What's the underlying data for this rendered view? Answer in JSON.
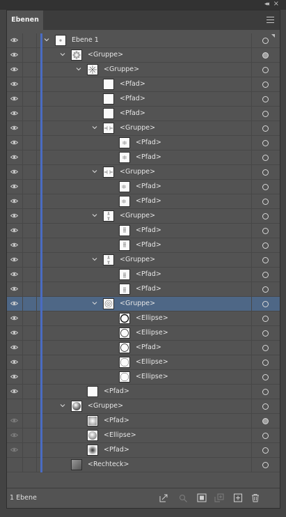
{
  "window": {
    "collapse_glyph": "◂◂",
    "close_glyph": "×"
  },
  "tab": {
    "label": "Ebenen"
  },
  "menu": {
    "icon": "panel-menu-icon"
  },
  "colors": {
    "layer_color": "#4a6cc2",
    "selection": "#4e6786",
    "panel_bg": "#535353"
  },
  "rows": [
    {
      "label": "Ebene 1",
      "indent": 0,
      "chevron": "open",
      "thumb": "layer-dot",
      "visible": true,
      "target": "empty",
      "selected": false,
      "type": "layer"
    },
    {
      "label": "<Gruppe>",
      "indent": 1,
      "chevron": "open",
      "thumb": "gear",
      "visible": true,
      "target": "filled",
      "selected": false
    },
    {
      "label": "<Gruppe>",
      "indent": 2,
      "chevron": "open",
      "thumb": "star",
      "visible": true,
      "target": "empty",
      "selected": false
    },
    {
      "label": "<Pfad>",
      "indent": 3,
      "chevron": "none",
      "thumb": "blank",
      "visible": true,
      "target": "empty",
      "selected": false
    },
    {
      "label": "<Pfad>",
      "indent": 3,
      "chevron": "none",
      "thumb": "blank",
      "visible": true,
      "target": "empty",
      "selected": false
    },
    {
      "label": "<Pfad>",
      "indent": 3,
      "chevron": "none",
      "thumb": "blank",
      "visible": true,
      "target": "empty",
      "selected": false
    },
    {
      "label": "<Gruppe>",
      "indent": 3,
      "chevron": "open",
      "thumb": "hline",
      "visible": true,
      "target": "empty",
      "selected": false
    },
    {
      "label": "<Pfad>",
      "indent": 4,
      "chevron": "none",
      "thumb": "hright",
      "visible": true,
      "target": "empty",
      "selected": false
    },
    {
      "label": "<Pfad>",
      "indent": 4,
      "chevron": "none",
      "thumb": "hright",
      "visible": true,
      "target": "empty",
      "selected": false
    },
    {
      "label": "<Gruppe>",
      "indent": 3,
      "chevron": "open",
      "thumb": "hline",
      "visible": true,
      "target": "empty",
      "selected": false
    },
    {
      "label": "<Pfad>",
      "indent": 4,
      "chevron": "none",
      "thumb": "hleft",
      "visible": true,
      "target": "empty",
      "selected": false
    },
    {
      "label": "<Pfad>",
      "indent": 4,
      "chevron": "none",
      "thumb": "hleft",
      "visible": true,
      "target": "empty",
      "selected": false
    },
    {
      "label": "<Gruppe>",
      "indent": 3,
      "chevron": "open",
      "thumb": "vline",
      "visible": true,
      "target": "empty",
      "selected": false
    },
    {
      "label": "<Pfad>",
      "indent": 4,
      "chevron": "none",
      "thumb": "vtop",
      "visible": true,
      "target": "empty",
      "selected": false
    },
    {
      "label": "<Pfad>",
      "indent": 4,
      "chevron": "none",
      "thumb": "vtop",
      "visible": true,
      "target": "empty",
      "selected": false
    },
    {
      "label": "<Gruppe>",
      "indent": 3,
      "chevron": "open",
      "thumb": "vline",
      "visible": true,
      "target": "empty",
      "selected": false
    },
    {
      "label": "<Pfad>",
      "indent": 4,
      "chevron": "none",
      "thumb": "vbottom",
      "visible": true,
      "target": "empty",
      "selected": false
    },
    {
      "label": "<Pfad>",
      "indent": 4,
      "chevron": "none",
      "thumb": "vbottom",
      "visible": true,
      "target": "empty",
      "selected": false
    },
    {
      "label": "<Gruppe>",
      "indent": 3,
      "chevron": "open",
      "thumb": "target-circle",
      "visible": true,
      "target": "empty",
      "selected": true
    },
    {
      "label": "<Ellipse>",
      "indent": 4,
      "chevron": "none",
      "thumb": "circle-thick",
      "visible": true,
      "target": "empty",
      "selected": false
    },
    {
      "label": "<Ellipse>",
      "indent": 4,
      "chevron": "none",
      "thumb": "circle",
      "visible": true,
      "target": "empty",
      "selected": false
    },
    {
      "label": "<Pfad>",
      "indent": 4,
      "chevron": "none",
      "thumb": "circle",
      "visible": true,
      "target": "empty",
      "selected": false
    },
    {
      "label": "<Ellipse>",
      "indent": 4,
      "chevron": "none",
      "thumb": "circle-thin",
      "visible": true,
      "target": "empty",
      "selected": false
    },
    {
      "label": "<Ellipse>",
      "indent": 4,
      "chevron": "none",
      "thumb": "circle-thin",
      "visible": true,
      "target": "empty",
      "selected": false
    },
    {
      "label": "<Pfad>",
      "indent": 2,
      "chevron": "none",
      "thumb": "blank",
      "visible": true,
      "target": "empty",
      "selected": false
    },
    {
      "label": "<Gruppe>",
      "indent": 1,
      "chevron": "open",
      "thumb": "sphere",
      "visible": false,
      "target": "empty",
      "selected": false
    },
    {
      "label": "<Pfad>",
      "indent": 2,
      "chevron": "none",
      "thumb": "gradient-soft",
      "visible": "dim",
      "target": "filled",
      "selected": false
    },
    {
      "label": "<Ellipse>",
      "indent": 2,
      "chevron": "none",
      "thumb": "gradient-sphere",
      "visible": "dim",
      "target": "empty",
      "selected": false
    },
    {
      "label": "<Pfad>",
      "indent": 2,
      "chevron": "none",
      "thumb": "gradient-dark",
      "visible": "dim",
      "target": "empty",
      "selected": false
    },
    {
      "label": "<Rechteck>",
      "indent": 1,
      "chevron": "none",
      "thumb": "gradient-rect",
      "visible": false,
      "target": "empty",
      "selected": false
    }
  ],
  "footer": {
    "count_label": "1 Ebene",
    "buttons": [
      {
        "name": "export-icon",
        "enabled": true
      },
      {
        "name": "locate-object-icon",
        "enabled": false
      },
      {
        "name": "clipping-mask-icon",
        "enabled": true
      },
      {
        "name": "new-sublayer-icon",
        "enabled": false
      },
      {
        "name": "new-layer-icon",
        "enabled": true
      },
      {
        "name": "delete-icon",
        "enabled": true
      }
    ]
  }
}
